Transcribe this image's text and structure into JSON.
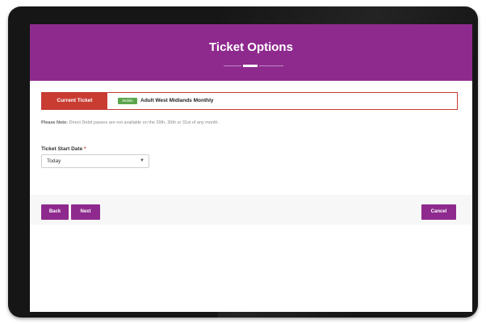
{
  "header": {
    "title": "Ticket Options"
  },
  "current_ticket": {
    "label": "Current Ticket",
    "badge": "Mobile",
    "name": "Adult West Midlands Monthly"
  },
  "note": {
    "prefix": "Please Note:",
    "text": " Direct Debit passes are not available on the 29th, 30th or 31st of any month."
  },
  "start_date": {
    "label": "Ticket Start Date",
    "required_mark": "*",
    "selected": "Today"
  },
  "buttons": {
    "back": "Back",
    "next": "Next",
    "cancel": "Cancel"
  },
  "colors": {
    "brand_purple": "#8e2a8e",
    "current_ticket_red": "#c83c32",
    "badge_green": "#5aa64c"
  }
}
